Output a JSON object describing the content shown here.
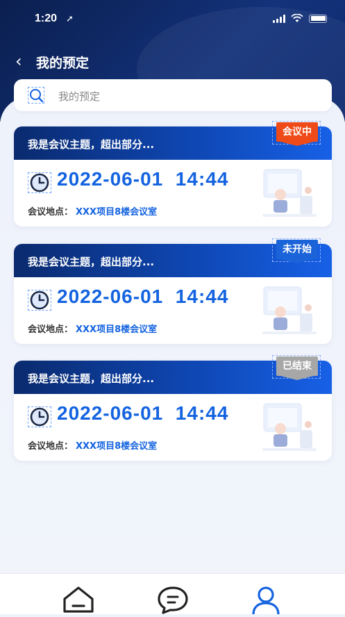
{
  "status": {
    "time": "1:20",
    "location_arrow": "➚"
  },
  "nav": {
    "back_icon": "‹",
    "title": "我的预定"
  },
  "search": {
    "placeholder": "我的预定"
  },
  "cards": [
    {
      "title": "我是会议主题，超出部分...",
      "status": "会议中",
      "status_color": "#ef4b18",
      "datetime_date": "2022-06-01",
      "datetime_time": "14:44",
      "location_label": "会议地点：",
      "location": "XXX项目8楼会议室"
    },
    {
      "title": "我是会议主题，超出部分...",
      "status": "未开始",
      "status_color": "#1a63d8",
      "datetime_date": "2022-06-01",
      "datetime_time": "14:44",
      "location_label": "会议地点：",
      "location": "XXX项目8楼会议室"
    },
    {
      "title": "我是会议主题，超出部分...",
      "status": "已结束",
      "status_color": "#a7a7a7",
      "datetime_date": "2022-06-01",
      "datetime_time": "14:44",
      "location_label": "会议地点：",
      "location": "XXX项目8楼会议室"
    }
  ],
  "tabbar": {
    "items": [
      {
        "icon": "home-icon",
        "active": false
      },
      {
        "icon": "message-icon",
        "active": false
      },
      {
        "icon": "user-icon",
        "active": true
      }
    ],
    "active_color": "#1463e0",
    "inactive_color": "#222222"
  }
}
